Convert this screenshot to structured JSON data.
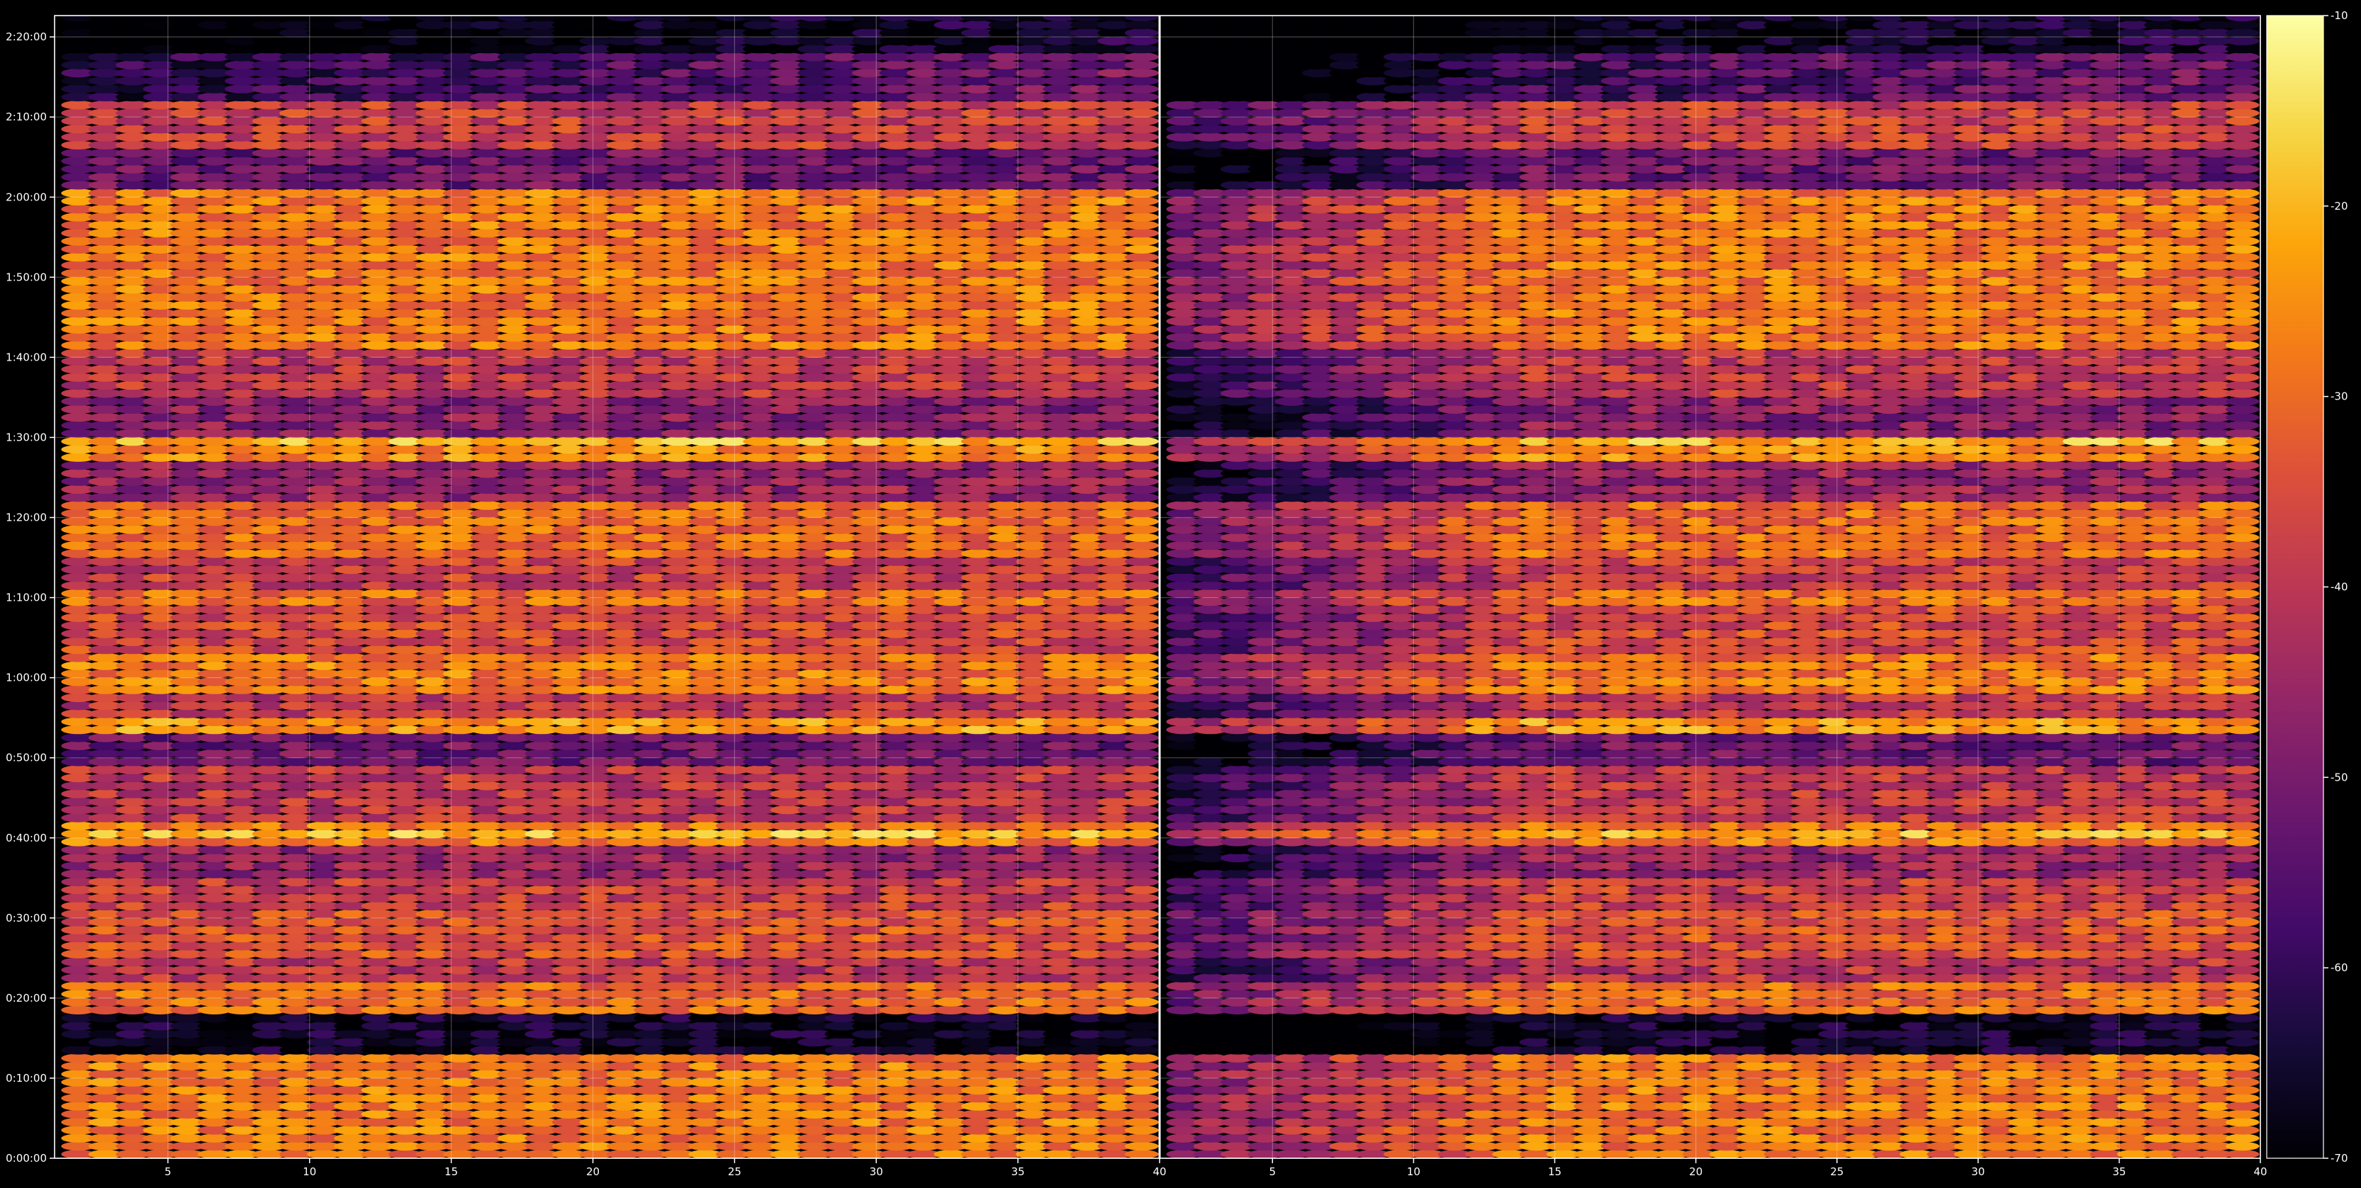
{
  "chart_data": {
    "type": "heatmap",
    "title": "",
    "xlabel": "",
    "ylabel": "",
    "colormap": "inferno",
    "background_color": "#000000",
    "axis_color": "#ffffff",
    "grid": true,
    "panels": [
      {
        "name": "",
        "x_range": [
          1,
          40
        ],
        "x_ticks": [
          {
            "value": 5,
            "label": "5"
          },
          {
            "value": 10,
            "label": "10"
          },
          {
            "value": 15,
            "label": "15"
          },
          {
            "value": 20,
            "label": "20"
          },
          {
            "value": 25,
            "label": "25"
          },
          {
            "value": 30,
            "label": "30"
          },
          {
            "value": 35,
            "label": "35"
          },
          {
            "value": 40,
            "label": "40"
          }
        ],
        "dim_low_columns_until": 1,
        "dim_strength": 0.0
      },
      {
        "name": "",
        "x_range": [
          1,
          40
        ],
        "x_ticks": [
          {
            "value": 5,
            "label": "5"
          },
          {
            "value": 10,
            "label": "10"
          },
          {
            "value": 15,
            "label": "15"
          },
          {
            "value": 20,
            "label": "20"
          },
          {
            "value": 25,
            "label": "25"
          },
          {
            "value": 30,
            "label": "30"
          },
          {
            "value": 35,
            "label": "35"
          },
          {
            "value": 40,
            "label": "40"
          }
        ],
        "dim_low_columns_until": 13,
        "dim_strength": 22.0
      }
    ],
    "y_range_seconds": [
      0,
      8560
    ],
    "y_ticks": [
      {
        "value": 0,
        "label": "0:00:00"
      },
      {
        "value": 600,
        "label": "0:10:00"
      },
      {
        "value": 1200,
        "label": "0:20:00"
      },
      {
        "value": 1800,
        "label": "0:30:00"
      },
      {
        "value": 2400,
        "label": "0:40:00"
      },
      {
        "value": 3000,
        "label": "0:50:00"
      },
      {
        "value": 3600,
        "label": "1:00:00"
      },
      {
        "value": 4200,
        "label": "1:10:00"
      },
      {
        "value": 4800,
        "label": "1:20:00"
      },
      {
        "value": 5400,
        "label": "1:30:00"
      },
      {
        "value": 6000,
        "label": "1:40:00"
      },
      {
        "value": 6600,
        "label": "1:50:00"
      },
      {
        "value": 7200,
        "label": "2:00:00"
      },
      {
        "value": 7800,
        "label": "2:10:00"
      },
      {
        "value": 8400,
        "label": "2:20:00"
      }
    ],
    "colorbar": {
      "range": [
        -70,
        -10
      ],
      "ticks": [
        {
          "value": -10,
          "label": "-10"
        },
        {
          "value": -20,
          "label": "-20"
        },
        {
          "value": -30,
          "label": "-30"
        },
        {
          "value": -40,
          "label": "-40"
        },
        {
          "value": -50,
          "label": "-50"
        },
        {
          "value": -60,
          "label": "-60"
        },
        {
          "value": -70,
          "label": "-70"
        }
      ]
    },
    "row_step_seconds": 60,
    "row_levels": [
      {
        "from": 0,
        "to": 780,
        "value": -28
      },
      {
        "from": 780,
        "to": 1080,
        "value": -66
      },
      {
        "from": 1080,
        "to": 1320,
        "value": -30
      },
      {
        "from": 1320,
        "to": 1500,
        "value": -40
      },
      {
        "from": 1500,
        "to": 1860,
        "value": -34
      },
      {
        "from": 1860,
        "to": 2100,
        "value": -38
      },
      {
        "from": 2100,
        "to": 2340,
        "value": -46
      },
      {
        "from": 2340,
        "to": 2520,
        "value": -28
      },
      {
        "from": 2520,
        "to": 2940,
        "value": -40
      },
      {
        "from": 2940,
        "to": 3180,
        "value": -52
      },
      {
        "from": 3180,
        "to": 3300,
        "value": -24
      },
      {
        "from": 3300,
        "to": 3480,
        "value": -40
      },
      {
        "from": 3480,
        "to": 3780,
        "value": -28
      },
      {
        "from": 3780,
        "to": 4140,
        "value": -36
      },
      {
        "from": 4140,
        "to": 4260,
        "value": -30
      },
      {
        "from": 4260,
        "to": 4500,
        "value": -38
      },
      {
        "from": 4500,
        "to": 4920,
        "value": -30
      },
      {
        "from": 4920,
        "to": 5220,
        "value": -46
      },
      {
        "from": 5220,
        "to": 5340,
        "value": -26
      },
      {
        "from": 5340,
        "to": 5700,
        "value": -48
      },
      {
        "from": 5700,
        "to": 6060,
        "value": -40
      },
      {
        "from": 6060,
        "to": 7260,
        "value": -28
      },
      {
        "from": 7260,
        "to": 7560,
        "value": -52
      },
      {
        "from": 7560,
        "to": 7920,
        "value": -38
      },
      {
        "from": 7920,
        "to": 8280,
        "value": -50
      },
      {
        "from": 8280,
        "to": 8560,
        "value": -62
      }
    ],
    "strong_rows": [
      {
        "t": 120,
        "value": -22
      },
      {
        "t": 300,
        "value": -22
      },
      {
        "t": 480,
        "value": -24
      },
      {
        "t": 1260,
        "value": -25
      },
      {
        "t": 1680,
        "value": -24
      },
      {
        "t": 2040,
        "value": -22
      },
      {
        "t": 2430,
        "value": -20
      },
      {
        "t": 3240,
        "value": -20
      },
      {
        "t": 3660,
        "value": -22
      },
      {
        "t": 4380,
        "value": -26
      },
      {
        "t": 4980,
        "value": -26
      },
      {
        "t": 5370,
        "value": -20
      },
      {
        "t": 6000,
        "value": -24
      },
      {
        "t": 6840,
        "value": -20
      },
      {
        "t": 7140,
        "value": -22
      },
      {
        "t": 7800,
        "value": -30
      }
    ]
  }
}
